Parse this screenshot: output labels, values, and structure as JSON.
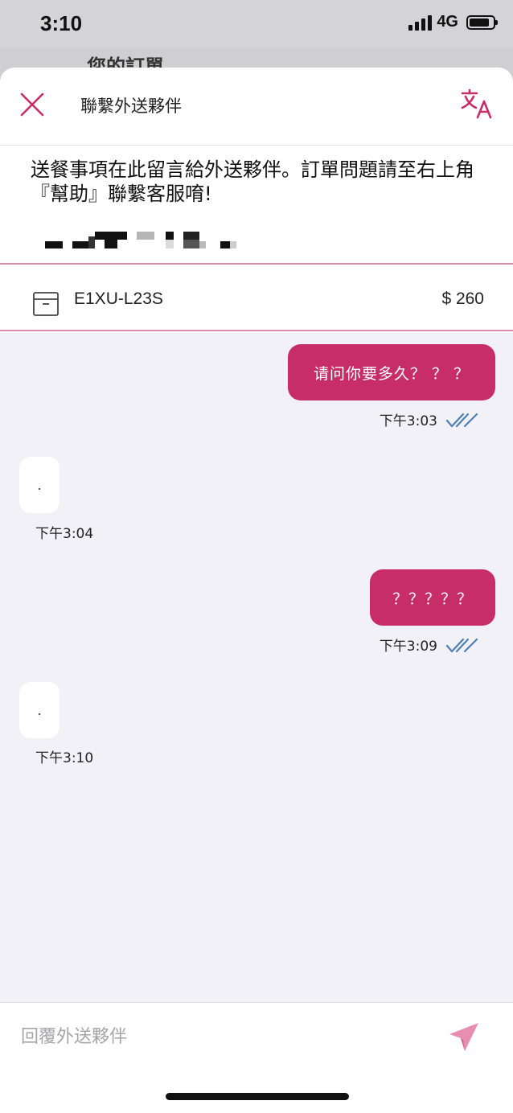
{
  "status_bar": {
    "time": "3:10",
    "network": "4G"
  },
  "behind_title": "您的訂單",
  "header": {
    "title": "聯繫外送夥伴",
    "close_icon": "close-icon",
    "translate_icon": "translate-icon"
  },
  "notice": {
    "text": "送餐事項在此留言給外送夥伴。訂單問題請至右上角『幫助』聯繫客服唷!"
  },
  "order": {
    "id": "E1XU-L23S",
    "price": "$ 260"
  },
  "messages": [
    {
      "direction": "outgoing",
      "text": "请问你要多久？ ？ ？",
      "time": "下午3:03",
      "read": true
    },
    {
      "direction": "incoming",
      "text": ".",
      "time": "下午3:04"
    },
    {
      "direction": "outgoing",
      "text": "？？？？？",
      "time": "下午3:09",
      "read": true
    },
    {
      "direction": "incoming",
      "text": ".",
      "time": "下午3:10"
    }
  ],
  "reply": {
    "placeholder": "回覆外送夥伴",
    "value": ""
  },
  "colors": {
    "accent": "#c72e68",
    "chat_background": "#f2f1f7",
    "divider": "#d98aae",
    "read_check": "#4f7fb0"
  }
}
